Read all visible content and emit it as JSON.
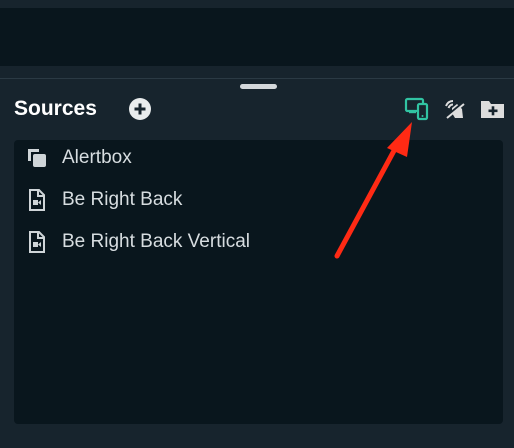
{
  "sources_panel": {
    "title": "Sources",
    "add_icon": "plus-circle-icon",
    "toolbar": [
      {
        "icon": "selective-recording-icon",
        "color": "#31c3a2"
      },
      {
        "icon": "audio-mute-icon",
        "color": "#dddddd"
      },
      {
        "icon": "add-folder-icon",
        "color": "#dddddd"
      }
    ],
    "items": [
      {
        "label": "Alertbox",
        "icon": "copy-icon"
      },
      {
        "label": "Be Right Back",
        "icon": "video-file-icon"
      },
      {
        "label": "Be Right Back Vertical",
        "icon": "video-file-icon"
      }
    ]
  },
  "annotation": {
    "arrow_color": "#ff2a14"
  }
}
